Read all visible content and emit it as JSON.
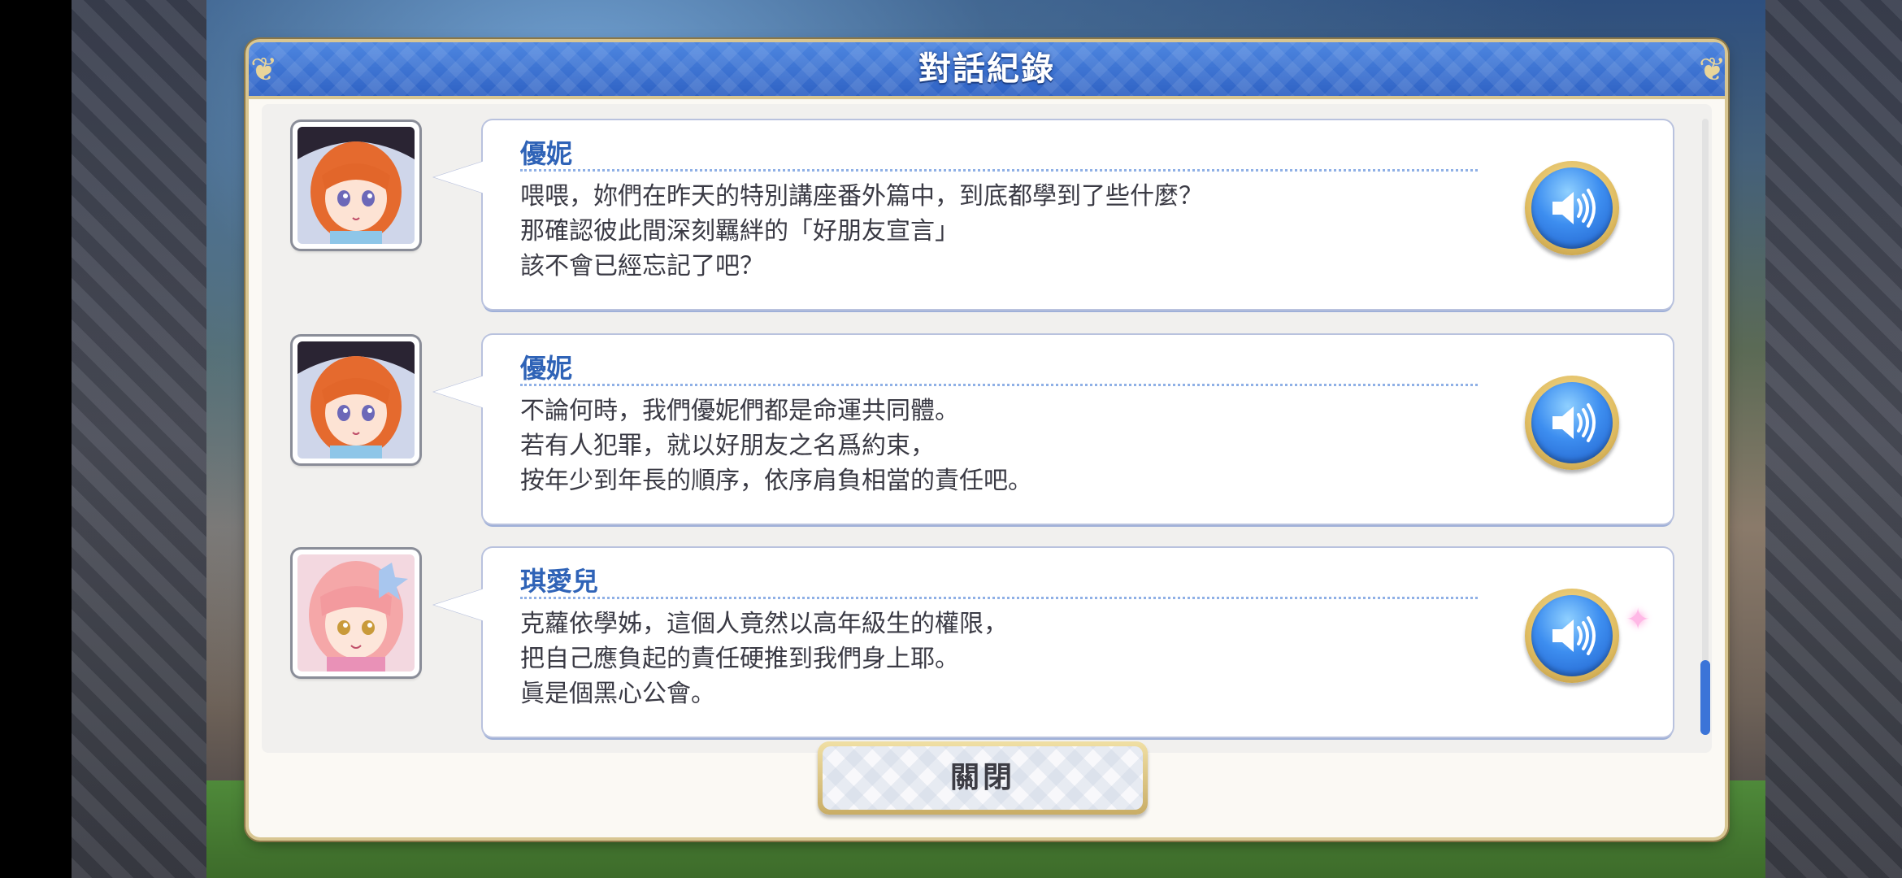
{
  "dialog": {
    "title": "對話紀錄",
    "close_label": "關閉"
  },
  "log": {
    "entries": [
      {
        "speaker": "優妮",
        "lines": [
          "喂喂，妳們在昨天的特別講座番外篇中，到底都學到了些什麼？",
          "那確認彼此間深刻羈絆的「好朋友宣言」",
          "該不會已經忘記了吧？"
        ],
        "portrait": "character-portrait-yuni",
        "voice_icon": "speaker-icon"
      },
      {
        "speaker": "優妮",
        "lines": [
          "不論何時，我們優妮們都是命運共同體。",
          "若有人犯罪，就以好朋友之名爲約束，",
          "按年少到年長的順序，依序肩負相當的責任吧。"
        ],
        "portrait": "character-portrait-yuni",
        "voice_icon": "speaker-icon"
      },
      {
        "speaker": "琪愛兒",
        "lines": [
          "克蘿依學姊，這個人竟然以高年級生的權限，",
          "把自己應負起的責任硬推到我們身上耶。",
          "眞是個黑心公會。"
        ],
        "portrait": "character-portrait-chieru",
        "voice_icon": "speaker-icon"
      }
    ]
  },
  "colors": {
    "header_blue": "#3a6fd0",
    "name_blue": "#2f63b7",
    "gold_border": "#d8c692",
    "scroll_thumb": "#3b74d8"
  }
}
